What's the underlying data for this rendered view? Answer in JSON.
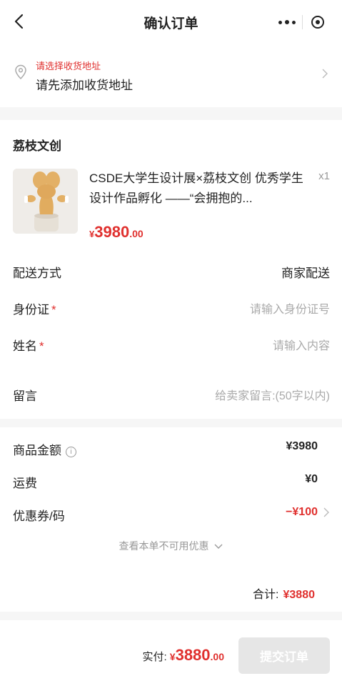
{
  "header": {
    "title": "确认订单"
  },
  "address": {
    "warning": "请选择收货地址",
    "hint": "请先添加收货地址"
  },
  "shop": {
    "name": "荔枝文创"
  },
  "product": {
    "name": "CSDE大学生设计展×荔枝文创 优秀学生设计作品孵化 ——“会拥抱的...",
    "quantity": "x1",
    "price_currency": "¥",
    "price_int": "3980",
    "price_dec": ".00"
  },
  "fields": {
    "delivery_label": "配送方式",
    "delivery_value": "商家配送",
    "id_label": "身份证",
    "id_placeholder": "请输入身份证号",
    "name_label": "姓名",
    "name_placeholder": "请输入内容",
    "note_label": "留言",
    "note_placeholder": "给卖家留言:(50字以内)",
    "required_mark": "*"
  },
  "summary": {
    "goods_label": "商品金额",
    "goods_value": "¥3980",
    "shipping_label": "运费",
    "shipping_value": "¥0",
    "coupon_label": "优惠券/码",
    "coupon_value": "−¥100",
    "unavailable_text": "查看本单不可用优惠",
    "total_label": "合计:",
    "total_value": "¥3880"
  },
  "footer": {
    "pay_label": "实付:",
    "pay_currency": "¥",
    "pay_int": "3880",
    "pay_dec": ".00",
    "submit_label": "提交订单"
  },
  "colors": {
    "accent": "#e0302e",
    "disabled_button": "#e6e6e6",
    "background": "#f6f6f6"
  }
}
